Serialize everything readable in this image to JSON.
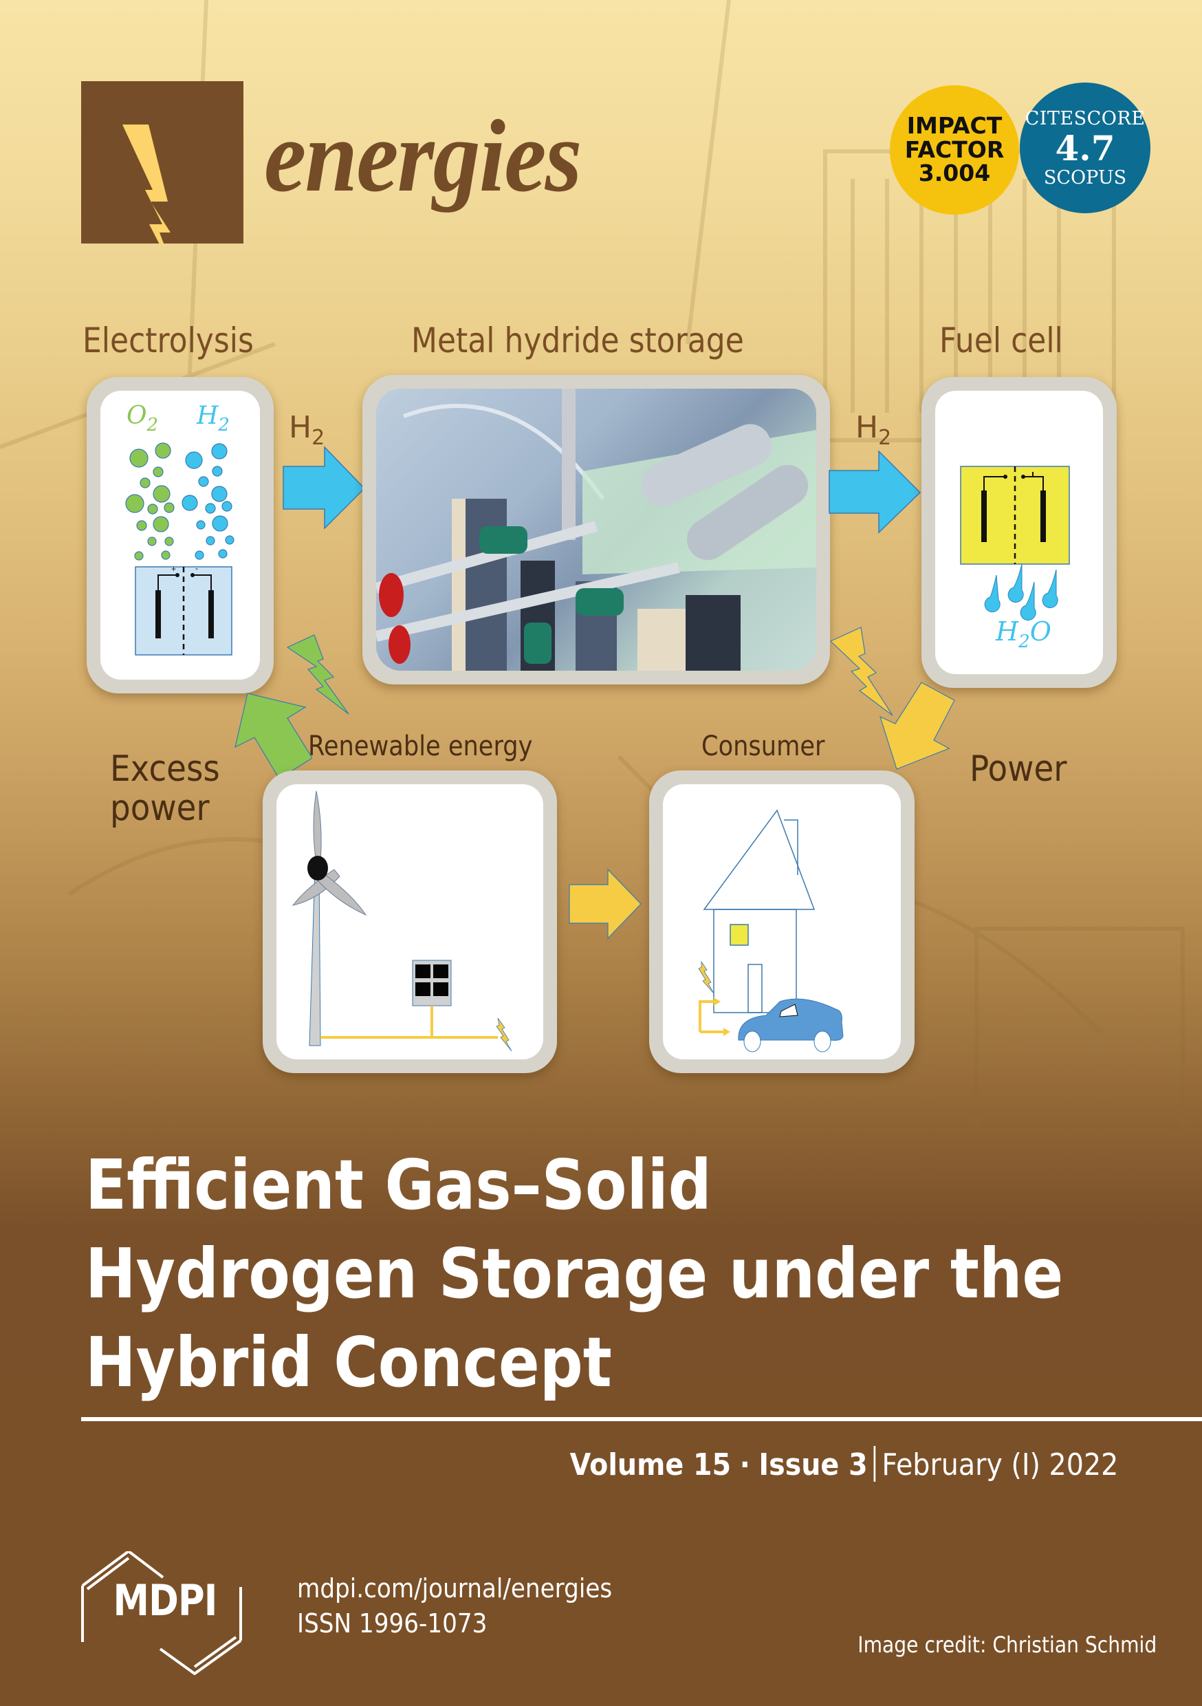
{
  "journal": {
    "name": "energies",
    "brand_color": "#764d29",
    "accent_color": "#fdd36b",
    "logo_icon": "lightning-bolt-icon"
  },
  "badges": {
    "impact_factor": {
      "line1": "IMPACT",
      "line2": "FACTOR",
      "value": "3.004",
      "color": "#f5c20e"
    },
    "citescore": {
      "line1": "CITESCORE",
      "value": "4.7",
      "line3": "SCOPUS",
      "color": "#0d6c91"
    }
  },
  "diagram": {
    "labels": {
      "electrolysis": "Electrolysis",
      "metal_hydride": "Metal hydride storage",
      "fuel_cell": "Fuel cell",
      "excess_power_1": "Excess",
      "excess_power_2": "power",
      "renewable": "Renewable energy",
      "consumer": "Consumer",
      "power": "Power"
    },
    "h2_label": "H",
    "h2_sub": "2",
    "electrolysis_box": {
      "o2": "O",
      "o2_sub": "2",
      "h2": "H",
      "h2_sub": "2",
      "plus": "+",
      "minus": "-"
    },
    "fuel_cell_box": {
      "water": "H",
      "water_sub": "2",
      "water_o": "O"
    },
    "colors": {
      "h2_arrow": "#3fc3ec",
      "green": "#8bc653",
      "yellow": "#f5cc44",
      "o2_bubble": "#8bc653",
      "h2_bubble": "#3fc3ec"
    }
  },
  "title": {
    "line1": "Efficient Gas–Solid",
    "line2": "Hydrogen Storage under the",
    "line3": "Hybrid Concept"
  },
  "issue": {
    "volume": "Volume 15",
    "dot": "·",
    "issue": "Issue 3",
    "date": "February (I) 2022"
  },
  "footer": {
    "publisher": "MDPI",
    "url": "mdpi.com/journal/energies",
    "issn": "ISSN 1996-1073",
    "credit": "Image credit: Christian Schmid"
  }
}
